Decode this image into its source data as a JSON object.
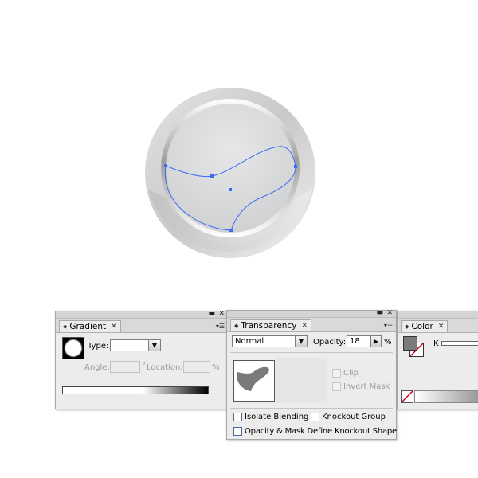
{
  "gradient_panel": {
    "tab_label": "Gradient",
    "type_label": "Type:",
    "type_value": "",
    "angle_label": "Angle:",
    "angle_value": "",
    "degree_symbol": "°",
    "location_label": "Location:",
    "location_value": "",
    "percent_symbol": "%"
  },
  "transparency_panel": {
    "tab_label": "Transparency",
    "blend_mode": "Normal",
    "opacity_label": "Opacity:",
    "opacity_value": "18",
    "percent_symbol": "%",
    "clip_label": "Clip",
    "invert_mask_label": "Invert Mask",
    "isolate_blending_label": "Isolate Blending",
    "knockout_group_label": "Knockout Group",
    "opacity_mask_label": "Opacity & Mask Define Knockout Shape"
  },
  "color_panel": {
    "tab_label": "Color",
    "channel_label": "K"
  },
  "icons": {
    "window_minimize": "minimize-icon",
    "window_close": "close-icon",
    "tab_reorder": "updown-arrows-icon",
    "panel_menu": "panel-menu-icon",
    "dropdown": "chevron-down-icon",
    "opacity_stepper": "chevron-right-icon"
  },
  "colors": {
    "selection_path": "#3b6cf0",
    "checkbox_border": "#4b6a92",
    "none_swatch_slash": "#c0001c"
  }
}
